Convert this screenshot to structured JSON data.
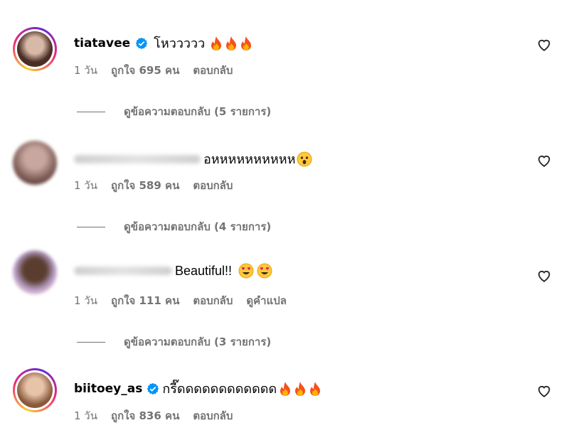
{
  "comments": [
    {
      "username": "tiatavee",
      "verified": true,
      "text": "โหววววว",
      "emojis": [
        "fire",
        "fire",
        "fire"
      ],
      "time": "1 วัน",
      "likes": "ถูกใจ 695 คน",
      "reply": "ตอบกลับ",
      "view_replies": "ดูข้อความตอบกลับ (5 รายการ)"
    },
    {
      "username": "",
      "verified": false,
      "text": "อหหหหหหหหหห",
      "emojis": [
        "astonished-face"
      ],
      "time": "1 วัน",
      "likes": "ถูกใจ 589 คน",
      "reply": "ตอบกลับ",
      "view_replies": "ดูข้อความตอบกลับ (4 รายการ)"
    },
    {
      "username": "",
      "verified": false,
      "text": "Beautiful!!",
      "emojis": [
        "heart-eyes-face",
        "heart-eyes-face"
      ],
      "time": "1 วัน",
      "likes": "ถูกใจ 111 คน",
      "reply": "ตอบกลับ",
      "translate": "ดูคำแปล",
      "view_replies": "ดูข้อความตอบกลับ (3 รายการ)"
    },
    {
      "username": "biitoey_as",
      "verified": true,
      "text": "กรี๊ดดดดดดดดดดดด",
      "emojis": [
        "fire",
        "fire",
        "fire"
      ],
      "time": "1 วัน",
      "likes": "ถูกใจ 836 คน",
      "reply": "ตอบกลับ"
    }
  ],
  "icons": {
    "like": "heart-outline-icon",
    "verified": "verified-badge-icon"
  },
  "colors": {
    "meta_text": "#737373",
    "verified_blue": "#0095f6"
  }
}
